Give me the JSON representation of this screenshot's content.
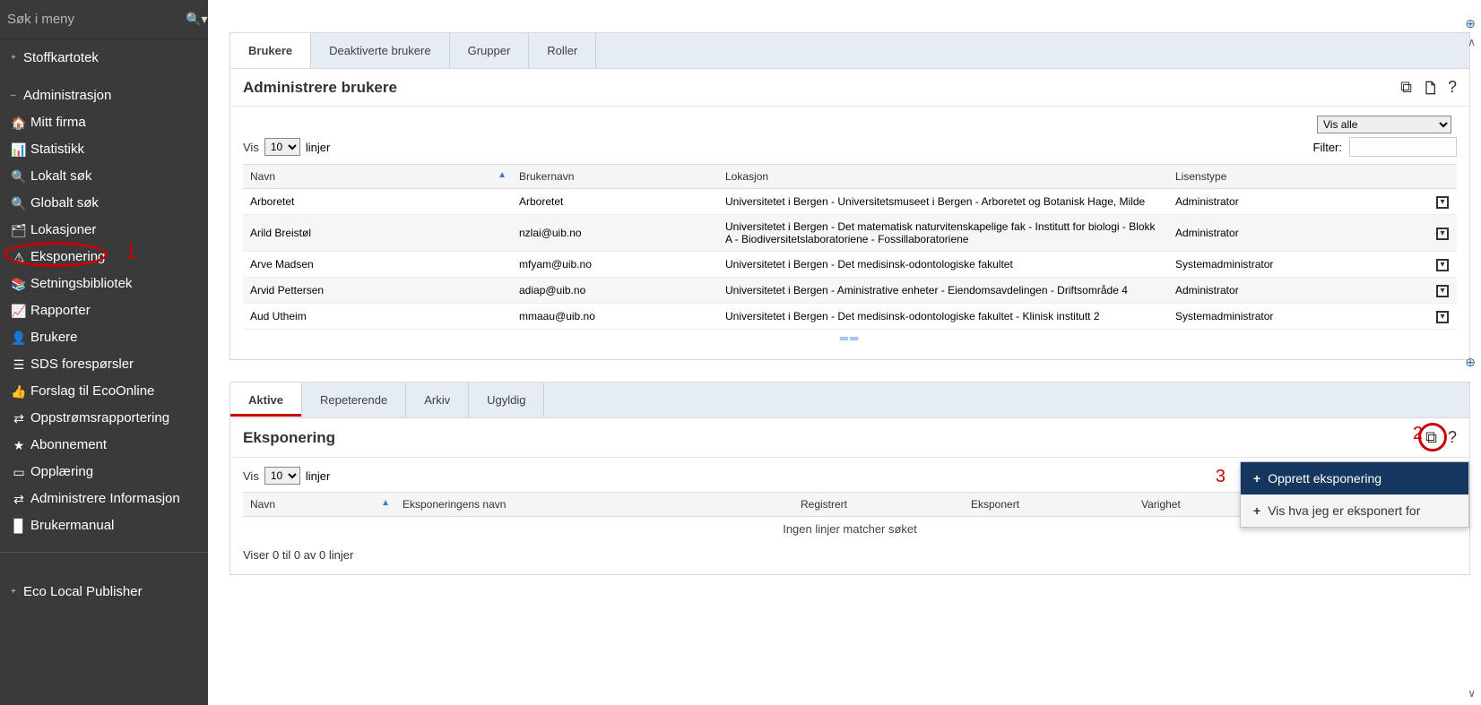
{
  "sidebar": {
    "search_placeholder": "Søk i meny",
    "section_stoffkartotek": "Stoffkartotek",
    "section_admin": "Administrasjon",
    "items": [
      {
        "label": "Mitt firma"
      },
      {
        "label": "Statistikk"
      },
      {
        "label": "Lokalt søk"
      },
      {
        "label": "Globalt søk"
      },
      {
        "label": "Lokasjoner"
      },
      {
        "label": "Eksponering"
      },
      {
        "label": "Setningsbibliotek"
      },
      {
        "label": "Rapporter"
      },
      {
        "label": "Brukere"
      },
      {
        "label": "SDS forespørsler"
      },
      {
        "label": "Forslag til EcoOnline"
      },
      {
        "label": "Oppstrømsrapportering"
      },
      {
        "label": "Abonnement"
      },
      {
        "label": "Opplæring"
      },
      {
        "label": "Administrere Informasjon"
      },
      {
        "label": "Brukermanual"
      }
    ],
    "section_eco": "Eco Local Publisher",
    "annot1": "1"
  },
  "users_panel": {
    "tabs": [
      "Brukere",
      "Deaktiverte brukere",
      "Grupper",
      "Roller"
    ],
    "title": "Administrere brukere",
    "show_label": "Vis",
    "page_size": "10",
    "lines_label": "linjer",
    "vis_all": "Vis alle",
    "filter_label": "Filter:",
    "columns": [
      "Navn",
      "Brukernavn",
      "Lokasjon",
      "Lisenstype"
    ],
    "rows": [
      {
        "name": "Arboretet",
        "user": "Arboretet",
        "loc": "Universitetet i Bergen - Universitetsmuseet i Bergen - Arboretet og Botanisk Hage, Milde",
        "lic": "Administrator"
      },
      {
        "name": "Arild Breistøl",
        "user": "nzlai@uib.no",
        "loc": "Universitetet i Bergen - Det matematisk naturvitenskapelige fak - Institutt for biologi - Blokk A - Biodiversitetslaboratoriene - Fossillaboratoriene",
        "lic": "Administrator"
      },
      {
        "name": "Arve Madsen",
        "user": "mfyam@uib.no",
        "loc": "Universitetet i Bergen - Det medisinsk-odontologiske fakultet",
        "lic": "Systemadministrator"
      },
      {
        "name": "Arvid Pettersen",
        "user": "adiap@uib.no",
        "loc": "Universitetet i Bergen - Aministrative enheter - Eiendomsavdelingen - Driftsområde 4",
        "lic": "Administrator"
      },
      {
        "name": "Aud Utheim",
        "user": "mmaau@uib.no",
        "loc": "Universitetet i Bergen - Det medisinsk-odontologiske fakultet - Klinisk institutt 2",
        "lic": "Systemadministrator"
      }
    ]
  },
  "exposure_panel": {
    "tabs": [
      "Aktive",
      "Repeterende",
      "Arkiv",
      "Ugyldig"
    ],
    "title": "Eksponering",
    "show_label": "Vis",
    "page_size": "10",
    "lines_label": "linjer",
    "columns": [
      "Navn",
      "Eksponeringens navn",
      "Registrert",
      "Eksponert",
      "Varighet"
    ],
    "no_data": "Ingen linjer matcher søket",
    "result_summary": "Viser 0 til 0 av 0 linjer",
    "annot2": "2",
    "annot3": "3",
    "menu": {
      "opprett": "Opprett eksponering",
      "vis": "Vis hva jeg er eksponert for"
    }
  }
}
